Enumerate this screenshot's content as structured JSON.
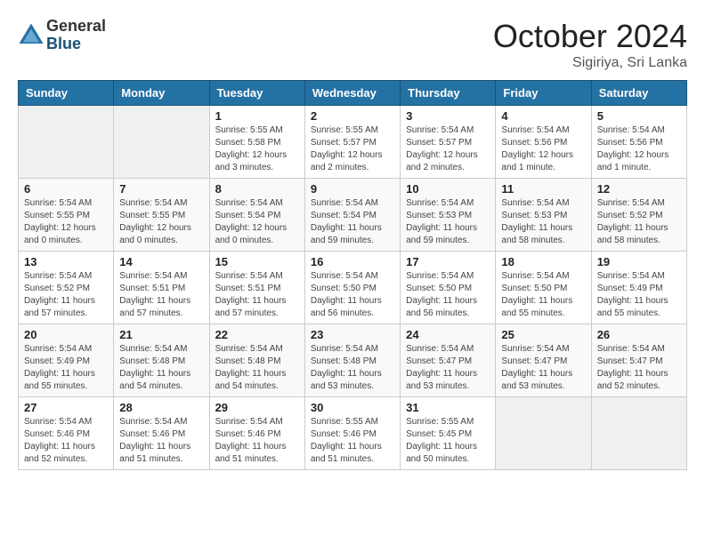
{
  "logo": {
    "general": "General",
    "blue": "Blue"
  },
  "title": "October 2024",
  "location": "Sigiriya, Sri Lanka",
  "weekdays": [
    "Sunday",
    "Monday",
    "Tuesday",
    "Wednesday",
    "Thursday",
    "Friday",
    "Saturday"
  ],
  "weeks": [
    [
      {
        "day": "",
        "sunrise": "",
        "sunset": "",
        "daylight": ""
      },
      {
        "day": "",
        "sunrise": "",
        "sunset": "",
        "daylight": ""
      },
      {
        "day": "1",
        "sunrise": "Sunrise: 5:55 AM",
        "sunset": "Sunset: 5:58 PM",
        "daylight": "Daylight: 12 hours and 3 minutes."
      },
      {
        "day": "2",
        "sunrise": "Sunrise: 5:55 AM",
        "sunset": "Sunset: 5:57 PM",
        "daylight": "Daylight: 12 hours and 2 minutes."
      },
      {
        "day": "3",
        "sunrise": "Sunrise: 5:54 AM",
        "sunset": "Sunset: 5:57 PM",
        "daylight": "Daylight: 12 hours and 2 minutes."
      },
      {
        "day": "4",
        "sunrise": "Sunrise: 5:54 AM",
        "sunset": "Sunset: 5:56 PM",
        "daylight": "Daylight: 12 hours and 1 minute."
      },
      {
        "day": "5",
        "sunrise": "Sunrise: 5:54 AM",
        "sunset": "Sunset: 5:56 PM",
        "daylight": "Daylight: 12 hours and 1 minute."
      }
    ],
    [
      {
        "day": "6",
        "sunrise": "Sunrise: 5:54 AM",
        "sunset": "Sunset: 5:55 PM",
        "daylight": "Daylight: 12 hours and 0 minutes."
      },
      {
        "day": "7",
        "sunrise": "Sunrise: 5:54 AM",
        "sunset": "Sunset: 5:55 PM",
        "daylight": "Daylight: 12 hours and 0 minutes."
      },
      {
        "day": "8",
        "sunrise": "Sunrise: 5:54 AM",
        "sunset": "Sunset: 5:54 PM",
        "daylight": "Daylight: 12 hours and 0 minutes."
      },
      {
        "day": "9",
        "sunrise": "Sunrise: 5:54 AM",
        "sunset": "Sunset: 5:54 PM",
        "daylight": "Daylight: 11 hours and 59 minutes."
      },
      {
        "day": "10",
        "sunrise": "Sunrise: 5:54 AM",
        "sunset": "Sunset: 5:53 PM",
        "daylight": "Daylight: 11 hours and 59 minutes."
      },
      {
        "day": "11",
        "sunrise": "Sunrise: 5:54 AM",
        "sunset": "Sunset: 5:53 PM",
        "daylight": "Daylight: 11 hours and 58 minutes."
      },
      {
        "day": "12",
        "sunrise": "Sunrise: 5:54 AM",
        "sunset": "Sunset: 5:52 PM",
        "daylight": "Daylight: 11 hours and 58 minutes."
      }
    ],
    [
      {
        "day": "13",
        "sunrise": "Sunrise: 5:54 AM",
        "sunset": "Sunset: 5:52 PM",
        "daylight": "Daylight: 11 hours and 57 minutes."
      },
      {
        "day": "14",
        "sunrise": "Sunrise: 5:54 AM",
        "sunset": "Sunset: 5:51 PM",
        "daylight": "Daylight: 11 hours and 57 minutes."
      },
      {
        "day": "15",
        "sunrise": "Sunrise: 5:54 AM",
        "sunset": "Sunset: 5:51 PM",
        "daylight": "Daylight: 11 hours and 57 minutes."
      },
      {
        "day": "16",
        "sunrise": "Sunrise: 5:54 AM",
        "sunset": "Sunset: 5:50 PM",
        "daylight": "Daylight: 11 hours and 56 minutes."
      },
      {
        "day": "17",
        "sunrise": "Sunrise: 5:54 AM",
        "sunset": "Sunset: 5:50 PM",
        "daylight": "Daylight: 11 hours and 56 minutes."
      },
      {
        "day": "18",
        "sunrise": "Sunrise: 5:54 AM",
        "sunset": "Sunset: 5:50 PM",
        "daylight": "Daylight: 11 hours and 55 minutes."
      },
      {
        "day": "19",
        "sunrise": "Sunrise: 5:54 AM",
        "sunset": "Sunset: 5:49 PM",
        "daylight": "Daylight: 11 hours and 55 minutes."
      }
    ],
    [
      {
        "day": "20",
        "sunrise": "Sunrise: 5:54 AM",
        "sunset": "Sunset: 5:49 PM",
        "daylight": "Daylight: 11 hours and 55 minutes."
      },
      {
        "day": "21",
        "sunrise": "Sunrise: 5:54 AM",
        "sunset": "Sunset: 5:48 PM",
        "daylight": "Daylight: 11 hours and 54 minutes."
      },
      {
        "day": "22",
        "sunrise": "Sunrise: 5:54 AM",
        "sunset": "Sunset: 5:48 PM",
        "daylight": "Daylight: 11 hours and 54 minutes."
      },
      {
        "day": "23",
        "sunrise": "Sunrise: 5:54 AM",
        "sunset": "Sunset: 5:48 PM",
        "daylight": "Daylight: 11 hours and 53 minutes."
      },
      {
        "day": "24",
        "sunrise": "Sunrise: 5:54 AM",
        "sunset": "Sunset: 5:47 PM",
        "daylight": "Daylight: 11 hours and 53 minutes."
      },
      {
        "day": "25",
        "sunrise": "Sunrise: 5:54 AM",
        "sunset": "Sunset: 5:47 PM",
        "daylight": "Daylight: 11 hours and 53 minutes."
      },
      {
        "day": "26",
        "sunrise": "Sunrise: 5:54 AM",
        "sunset": "Sunset: 5:47 PM",
        "daylight": "Daylight: 11 hours and 52 minutes."
      }
    ],
    [
      {
        "day": "27",
        "sunrise": "Sunrise: 5:54 AM",
        "sunset": "Sunset: 5:46 PM",
        "daylight": "Daylight: 11 hours and 52 minutes."
      },
      {
        "day": "28",
        "sunrise": "Sunrise: 5:54 AM",
        "sunset": "Sunset: 5:46 PM",
        "daylight": "Daylight: 11 hours and 51 minutes."
      },
      {
        "day": "29",
        "sunrise": "Sunrise: 5:54 AM",
        "sunset": "Sunset: 5:46 PM",
        "daylight": "Daylight: 11 hours and 51 minutes."
      },
      {
        "day": "30",
        "sunrise": "Sunrise: 5:55 AM",
        "sunset": "Sunset: 5:46 PM",
        "daylight": "Daylight: 11 hours and 51 minutes."
      },
      {
        "day": "31",
        "sunrise": "Sunrise: 5:55 AM",
        "sunset": "Sunset: 5:45 PM",
        "daylight": "Daylight: 11 hours and 50 minutes."
      },
      {
        "day": "",
        "sunrise": "",
        "sunset": "",
        "daylight": ""
      },
      {
        "day": "",
        "sunrise": "",
        "sunset": "",
        "daylight": ""
      }
    ]
  ]
}
